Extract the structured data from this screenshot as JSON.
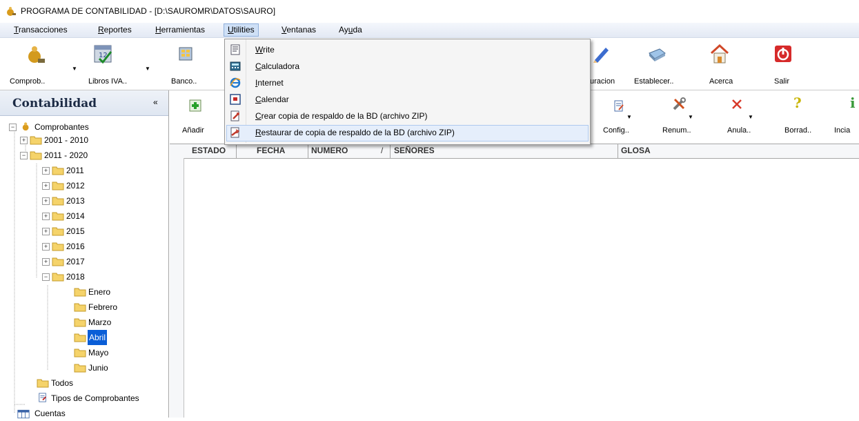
{
  "window": {
    "title": "PROGRAMA DE CONTABILIDAD - [D:\\SAUROMR\\DATOS\\SAURO]"
  },
  "menubar": [
    {
      "label": "Transacciones",
      "ul": "T",
      "rest": "ransacciones"
    },
    {
      "label": "Reportes",
      "ul": "R",
      "rest": "eportes"
    },
    {
      "label": "Herramientas",
      "ul": "H",
      "rest": "erramientas"
    },
    {
      "label": "Utilities",
      "ul": "U",
      "rest": "tilities"
    },
    {
      "label": "Ventanas",
      "ul": "V",
      "rest": "entanas"
    },
    {
      "label": "Ayuda",
      "pre": "Ay",
      "ul": "u",
      "rest": "da"
    }
  ],
  "toolbar": {
    "comprob": "Comprob..",
    "libros_iva": "Libros IVA..",
    "banco": "Banco..",
    "configuracion": "uracion",
    "establecer": "Establecer..",
    "acerca": "Acerca",
    "salir": "Salir"
  },
  "utilities_menu": [
    {
      "ul": "W",
      "rest": "rite"
    },
    {
      "ul": "C",
      "rest": "alculadora"
    },
    {
      "ul": "I",
      "rest": "nternet"
    },
    {
      "ul": "C",
      "rest": "alendar"
    },
    {
      "ul": "C",
      "rest": "rear copia de respaldo de la BD (archivo ZIP)"
    },
    {
      "ul": "R",
      "rest": "estaurar de copia de respaldo de la BD (archivo ZIP)"
    }
  ],
  "left_panel": {
    "title": "Contabilidad",
    "collapse": "«",
    "tree": {
      "comprobantes": "Comprobantes",
      "y2001": "2001 - 2010",
      "y2011": "2011 - 2020",
      "years": [
        "2011",
        "2012",
        "2013",
        "2014",
        "2015",
        "2016",
        "2017",
        "2018"
      ],
      "months": [
        "Enero",
        "Febrero",
        "Marzo",
        "Abril",
        "Mayo",
        "Junio"
      ],
      "todos": "Todos",
      "tipos": "Tipos de Comprobantes",
      "cuentas": "Cuentas"
    }
  },
  "sub_toolbar": {
    "anadir": "Añadir",
    "config": "Config..",
    "renum": "Renum..",
    "anula": "Anula..",
    "borrad": "Borrad..",
    "incia": "Incia"
  },
  "grid": {
    "columns": [
      "ESTADO",
      "FECHA",
      "NUMERO",
      "SEÑORES",
      "GLOSA"
    ],
    "sort_indicator": "/"
  },
  "colors": {
    "selection": "#0a5ed7",
    "menu_highlight": "#e5eefb",
    "menubar": "#e3e9f4"
  }
}
